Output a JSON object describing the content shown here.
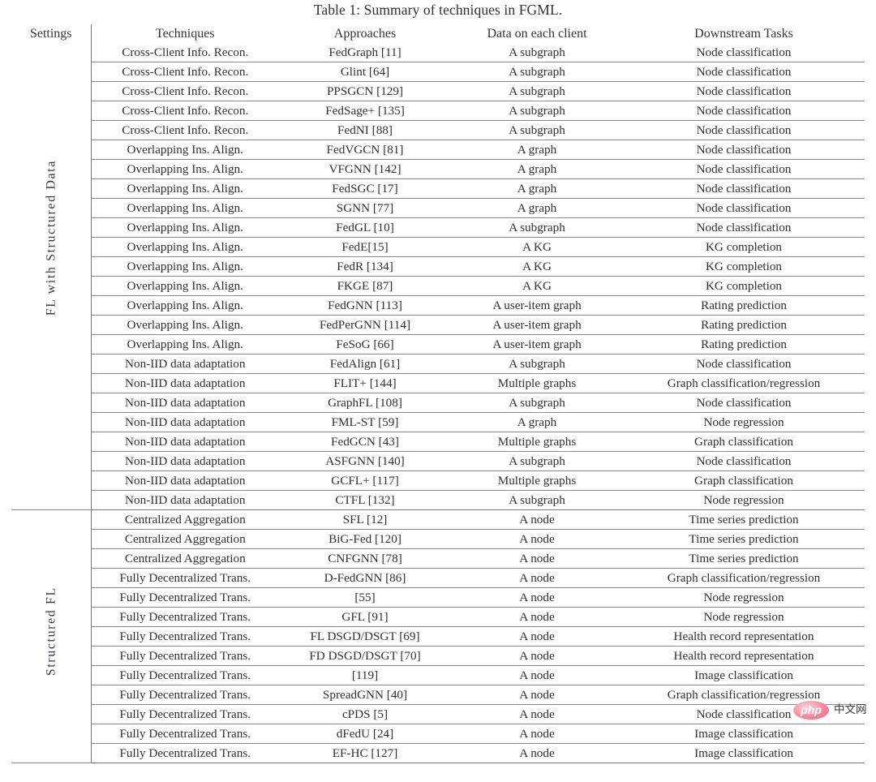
{
  "caption": "Table 1: Summary of techniques in FGML.",
  "columns": {
    "settings": "Settings",
    "techniques": "Techniques",
    "approaches": "Approaches",
    "data_on_client": "Data on each client",
    "downstream_tasks": "Downstream Tasks"
  },
  "groups": [
    {
      "label": "FL with Structured Data"
    },
    {
      "label": "Structured FL"
    }
  ],
  "rows": [
    {
      "group": 0,
      "technique": "Cross-Client Info. Recon.",
      "approach": "FedGraph [11]",
      "data": "A subgraph",
      "task": "Node classification"
    },
    {
      "group": 0,
      "technique": "Cross-Client Info. Recon.",
      "approach": "Glint [64]",
      "data": "A subgraph",
      "task": "Node classification"
    },
    {
      "group": 0,
      "technique": "Cross-Client Info. Recon.",
      "approach": "PPSGCN [129]",
      "data": "A subgraph",
      "task": "Node classification"
    },
    {
      "group": 0,
      "technique": "Cross-Client Info. Recon.",
      "approach": "FedSage+ [135]",
      "data": "A subgraph",
      "task": "Node classification"
    },
    {
      "group": 0,
      "technique": "Cross-Client Info. Recon.",
      "approach": "FedNI [88]",
      "data": "A subgraph",
      "task": "Node classification"
    },
    {
      "group": 0,
      "technique": "Overlapping Ins. Align.",
      "approach": "FedVGCN [81]",
      "data": "A graph",
      "task": "Node classification"
    },
    {
      "group": 0,
      "technique": "Overlapping Ins. Align.",
      "approach": "VFGNN [142]",
      "data": "A graph",
      "task": "Node classification"
    },
    {
      "group": 0,
      "technique": "Overlapping Ins. Align.",
      "approach": "FedSGC [17]",
      "data": "A graph",
      "task": "Node classification"
    },
    {
      "group": 0,
      "technique": "Overlapping Ins. Align.",
      "approach": "SGNN [77]",
      "data": "A graph",
      "task": "Node classification"
    },
    {
      "group": 0,
      "technique": "Overlapping Ins. Align.",
      "approach": "FedGL [10]",
      "data": "A subgraph",
      "task": "Node classification"
    },
    {
      "group": 0,
      "technique": "Overlapping Ins. Align.",
      "approach": "FedE[15]",
      "data": "A KG",
      "task": "KG completion"
    },
    {
      "group": 0,
      "technique": "Overlapping Ins. Align.",
      "approach": "FedR [134]",
      "data": "A KG",
      "task": "KG completion"
    },
    {
      "group": 0,
      "technique": "Overlapping Ins. Align.",
      "approach": "FKGE [87]",
      "data": "A KG",
      "task": "KG completion"
    },
    {
      "group": 0,
      "technique": "Overlapping Ins. Align.",
      "approach": "FedGNN [113]",
      "data": "A user-item graph",
      "task": "Rating prediction"
    },
    {
      "group": 0,
      "technique": "Overlapping Ins. Align.",
      "approach": "FedPerGNN [114]",
      "data": "A user-item graph",
      "task": "Rating prediction"
    },
    {
      "group": 0,
      "technique": "Overlapping Ins. Align.",
      "approach": "FeSoG [66]",
      "data": "A user-item graph",
      "task": "Rating prediction"
    },
    {
      "group": 0,
      "technique": "Non-IID data adaptation",
      "approach": "FedAlign [61]",
      "data": "A subgraph",
      "task": "Node classification"
    },
    {
      "group": 0,
      "technique": "Non-IID data adaptation",
      "approach": "FLIT+ [144]",
      "data": "Multiple graphs",
      "task": "Graph classification/regression"
    },
    {
      "group": 0,
      "technique": "Non-IID data adaptation",
      "approach": "GraphFL [108]",
      "data": "A subgraph",
      "task": "Node classification"
    },
    {
      "group": 0,
      "technique": "Non-IID data adaptation",
      "approach": "FML-ST [59]",
      "data": "A graph",
      "task": "Node regression"
    },
    {
      "group": 0,
      "technique": "Non-IID data adaptation",
      "approach": "FedGCN [43]",
      "data": "Multiple graphs",
      "task": "Graph classification"
    },
    {
      "group": 0,
      "technique": "Non-IID data adaptation",
      "approach": "ASFGNN [140]",
      "data": "A subgraph",
      "task": "Node classification"
    },
    {
      "group": 0,
      "technique": "Non-IID data adaptation",
      "approach": "GCFL+ [117]",
      "data": "Multiple graphs",
      "task": "Graph classification"
    },
    {
      "group": 0,
      "technique": "Non-IID data adaptation",
      "approach": "CTFL [132]",
      "data": "A subgraph",
      "task": "Node regression"
    },
    {
      "group": 1,
      "technique": "Centralized Aggregation",
      "approach": "SFL [12]",
      "data": "A node",
      "task": "Time series prediction"
    },
    {
      "group": 1,
      "technique": "Centralized Aggregation",
      "approach": "BiG-Fed [120]",
      "data": "A node",
      "task": "Time series prediction"
    },
    {
      "group": 1,
      "technique": "Centralized Aggregation",
      "approach": "CNFGNN [78]",
      "data": "A node",
      "task": "Time series prediction"
    },
    {
      "group": 1,
      "technique": "Fully Decentralized Trans.",
      "approach": "D-FedGNN [86]",
      "data": "A node",
      "task": "Graph classification/regression"
    },
    {
      "group": 1,
      "technique": "Fully Decentralized Trans.",
      "approach": "[55]",
      "data": "A node",
      "task": "Node regression"
    },
    {
      "group": 1,
      "technique": "Fully Decentralized Trans.",
      "approach": "GFL [91]",
      "data": "A node",
      "task": "Node regression"
    },
    {
      "group": 1,
      "technique": "Fully Decentralized Trans.",
      "approach": "FL DSGD/DSGT [69]",
      "data": "A node",
      "task": "Health record representation"
    },
    {
      "group": 1,
      "technique": "Fully Decentralized Trans.",
      "approach": "FD DSGD/DSGT [70]",
      "data": "A node",
      "task": "Health record representation"
    },
    {
      "group": 1,
      "technique": "Fully Decentralized Trans.",
      "approach": "[119]",
      "data": "A node",
      "task": "Image classification"
    },
    {
      "group": 1,
      "technique": "Fully Decentralized Trans.",
      "approach": "SpreadGNN [40]",
      "data": "A node",
      "task": "Graph classification/regression"
    },
    {
      "group": 1,
      "technique": "Fully Decentralized Trans.",
      "approach": "cPDS [5]",
      "data": "A node",
      "task": "Node classification"
    },
    {
      "group": 1,
      "technique": "Fully Decentralized Trans.",
      "approach": "dFedU [24]",
      "data": "A node",
      "task": "Image classification"
    },
    {
      "group": 1,
      "technique": "Fully Decentralized Trans.",
      "approach": "EF-HC [127]",
      "data": "A node",
      "task": "Image classification"
    }
  ],
  "watermark": {
    "logo_text": "php",
    "site_text": "中文网",
    "logo_color": "#ea5d7d"
  }
}
